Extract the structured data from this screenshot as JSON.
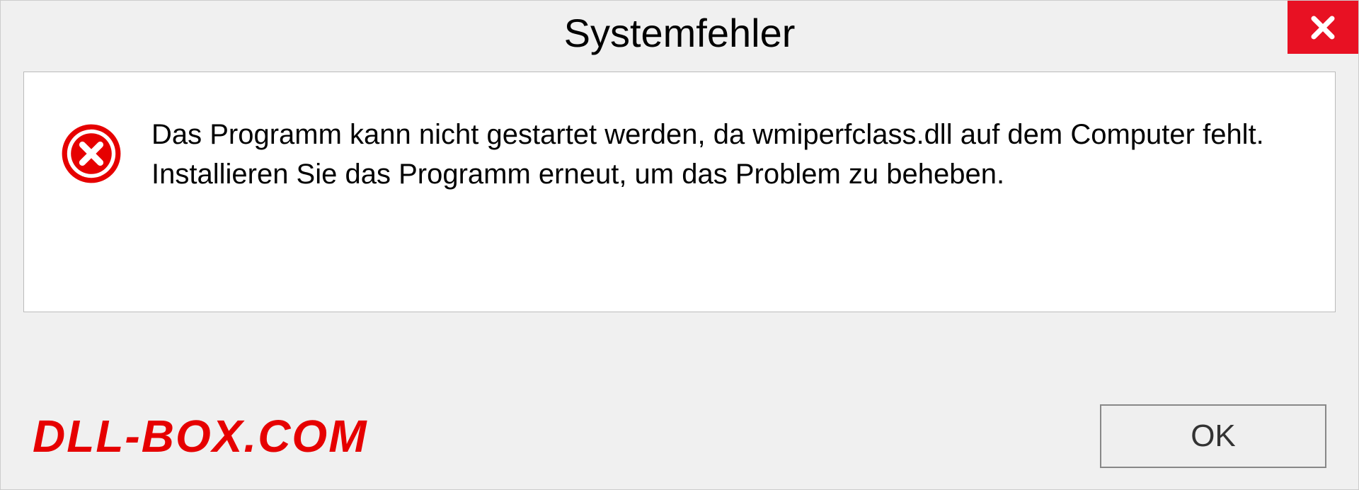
{
  "dialog": {
    "title": "Systemfehler",
    "message": "Das Programm kann nicht gestartet werden, da wmiperfclass.dll auf dem Computer fehlt. Installieren Sie das Programm erneut, um das Problem zu beheben.",
    "ok_label": "OK"
  },
  "watermark": "DLL-BOX.COM"
}
